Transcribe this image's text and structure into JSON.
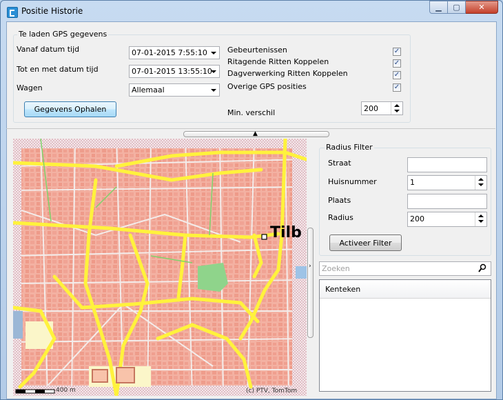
{
  "window": {
    "title": "Positie Historie"
  },
  "controls": {
    "minimize": "▁",
    "maximize": "▢",
    "close": "✕"
  },
  "gps": {
    "group_title": "Te laden GPS gegevens",
    "from_label": "Vanaf datum tijd",
    "from_value": "07-01-2015 7:55:10",
    "to_label": "Tot en met datum tijd",
    "to_value": "07-01-2015 13:55:10",
    "vehicle_label": "Wagen",
    "vehicle_value": "Allemaal",
    "fetch_button": "Gegevens Ophalen",
    "checks": [
      {
        "label": "Gebeurtenissen",
        "checked": true
      },
      {
        "label": "Ritagende Ritten Koppelen",
        "checked": true
      },
      {
        "label": "Dagverwerking Ritten Koppelen",
        "checked": true
      },
      {
        "label": "Overige GPS posities",
        "checked": true
      }
    ],
    "min_diff_label": "Min. verschil",
    "min_diff_value": "200"
  },
  "map": {
    "city_label": "Tilb",
    "scale_label": "400 m",
    "copyright": "(c) PTV, TomTom",
    "icons": {
      "collapse_up": "chevron-up-icon",
      "expand_right": "chevron-right-icon"
    }
  },
  "radius_filter": {
    "title": "Radius Filter",
    "street_label": "Straat",
    "street_value": "",
    "number_label": "Huisnummer",
    "number_value": "1",
    "place_label": "Plaats",
    "place_value": "",
    "radius_label": "Radius",
    "radius_value": "200",
    "activate_button": "Activeer Filter"
  },
  "search": {
    "placeholder": "Zoeken",
    "icon": "search-icon"
  },
  "vehicle_list": {
    "column_header": "Kenteken",
    "rows": []
  },
  "colors": {
    "map_block": "#f7b7a8",
    "map_road": "#fff23c",
    "map_park": "#8fd48b",
    "title_bar": "#c7dbf1"
  }
}
